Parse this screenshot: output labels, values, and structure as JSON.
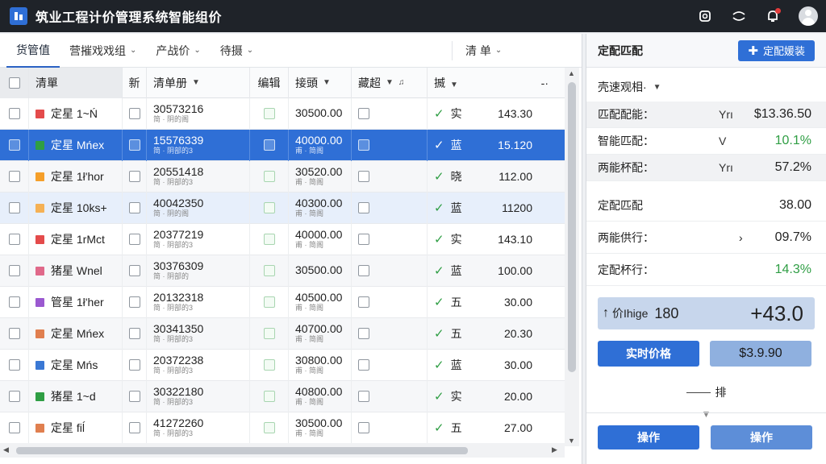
{
  "app": {
    "title": "筑业工程计价管理系统智能组价"
  },
  "tabs": [
    {
      "label": "货管值"
    },
    {
      "label": "营摧戏戏组"
    },
    {
      "label": "产战价"
    },
    {
      "label": "待摄"
    }
  ],
  "tab_right": {
    "label": "清 单"
  },
  "table": {
    "headers": {
      "c1": "清單",
      "c2": "新",
      "c3": "清单册",
      "c4": "编辑",
      "c5": "接頭",
      "c6": "藏超",
      "c7": "揻",
      "c7_more": "-·"
    },
    "rows": [
      {
        "color": "#e44b4b",
        "name": "定星 1~Ń",
        "code": "30573216",
        "code_sub": "简 · 阴的阁",
        "amount": "30500.00",
        "amount_sub": "",
        "status": "实",
        "price": "143.30",
        "state": "normal"
      },
      {
        "color": "#2f9e44",
        "name": "定星 Mńex",
        "code": "15576339",
        "code_sub": "简 · 阴部的3",
        "amount": "40000.00",
        "amount_sub": "甫 · 简阁",
        "status": "蓝",
        "price": "15.120",
        "state": "sel"
      },
      {
        "color": "#f59f2a",
        "name": "定星 1ł'hor",
        "code": "20551418",
        "code_sub": "简 · 阴部的3",
        "amount": "30520.00",
        "amount_sub": "甫 · 简阁",
        "status": "晓",
        "price": "112.00",
        "state": "alt"
      },
      {
        "color": "#f5b155",
        "name": "定星 10ks+",
        "code": "40042350",
        "code_sub": "简 · 阴的阁",
        "amount": "40300.00",
        "amount_sub": "甫 · 简阁",
        "status": "蓝",
        "price": "11200",
        "state": "light"
      },
      {
        "color": "#e44b4b",
        "name": "定星 1rMct",
        "code": "20377219",
        "code_sub": "简 · 阴部的3",
        "amount": "40000.00",
        "amount_sub": "甫 · 简阁",
        "status": "实",
        "price": "143.10",
        "state": "normal"
      },
      {
        "color": "#e0698a",
        "name": "猪星 Wnel",
        "code": "30376309",
        "code_sub": "简 · 阴部的",
        "amount": "30500.00",
        "amount_sub": "",
        "status": "蓝",
        "price": "100.00",
        "state": "alt"
      },
      {
        "color": "#9b59d0",
        "name": "管星 1ł'her",
        "code": "20132318",
        "code_sub": "简 · 阴部的3",
        "amount": "40500.00",
        "amount_sub": "甫 · 简阁",
        "status": "五",
        "price": "30.00",
        "state": "normal"
      },
      {
        "color": "#e07f4f",
        "name": "定星 Mńex",
        "code": "30341350",
        "code_sub": "简 · 阴部的3",
        "amount": "40700.00",
        "amount_sub": "甫 · 简阁",
        "status": "五",
        "price": "20.30",
        "state": "alt"
      },
      {
        "color": "#3a78d4",
        "name": "定星 Mńs",
        "code": "20372238",
        "code_sub": "简 · 阴部的3",
        "amount": "30800.00",
        "amount_sub": "甫 · 简阁",
        "status": "蓝",
        "price": "30.00",
        "state": "normal"
      },
      {
        "color": "#2f9e44",
        "name": "猪星 1~d",
        "code": "30322180",
        "code_sub": "简 · 阴部的3",
        "amount": "40800.00",
        "amount_sub": "甫 · 简阁",
        "status": "实",
        "price": "20.00",
        "state": "alt"
      },
      {
        "color": "#e07f4f",
        "name": "定星 fiĺ",
        "code": "41272260",
        "code_sub": "简 · 阴部的3",
        "amount": "30500.00",
        "amount_sub": "甫 · 简阁",
        "status": "五",
        "price": "27.00",
        "state": "normal"
      }
    ]
  },
  "side": {
    "title": "定配匹配",
    "primary_button": "定配媛装",
    "filter_label": "壳速观相·",
    "metrics": [
      {
        "label": "匹配配能：",
        "mid": "Yrı",
        "value": "$13.36.50",
        "green": false,
        "shade": true
      },
      {
        "label": "智能匹配：",
        "mid": "V",
        "value": "10.1%",
        "green": true,
        "shade": false
      },
      {
        "label": "两能杯配：",
        "mid": "Yrı",
        "value": "57.2%",
        "green": false,
        "shade": true
      }
    ],
    "metrics2": [
      {
        "label": "定配匹配",
        "mid": "",
        "value": "38.00",
        "green": false
      },
      {
        "label": "两能供行：",
        "mid": "›",
        "value": "09.7%",
        "green": false
      },
      {
        "label": "定配杯行：",
        "mid": "",
        "value": "14.3%",
        "green": true
      }
    ],
    "total": {
      "arrow": "↑",
      "label": "价Ihige",
      "label2": "180",
      "value": "+43.0"
    },
    "realtime_button": "实时价格",
    "price_button": "$3.9.90",
    "legend_label": "排",
    "bottom_left": "操作",
    "bottom_right": "操作"
  }
}
